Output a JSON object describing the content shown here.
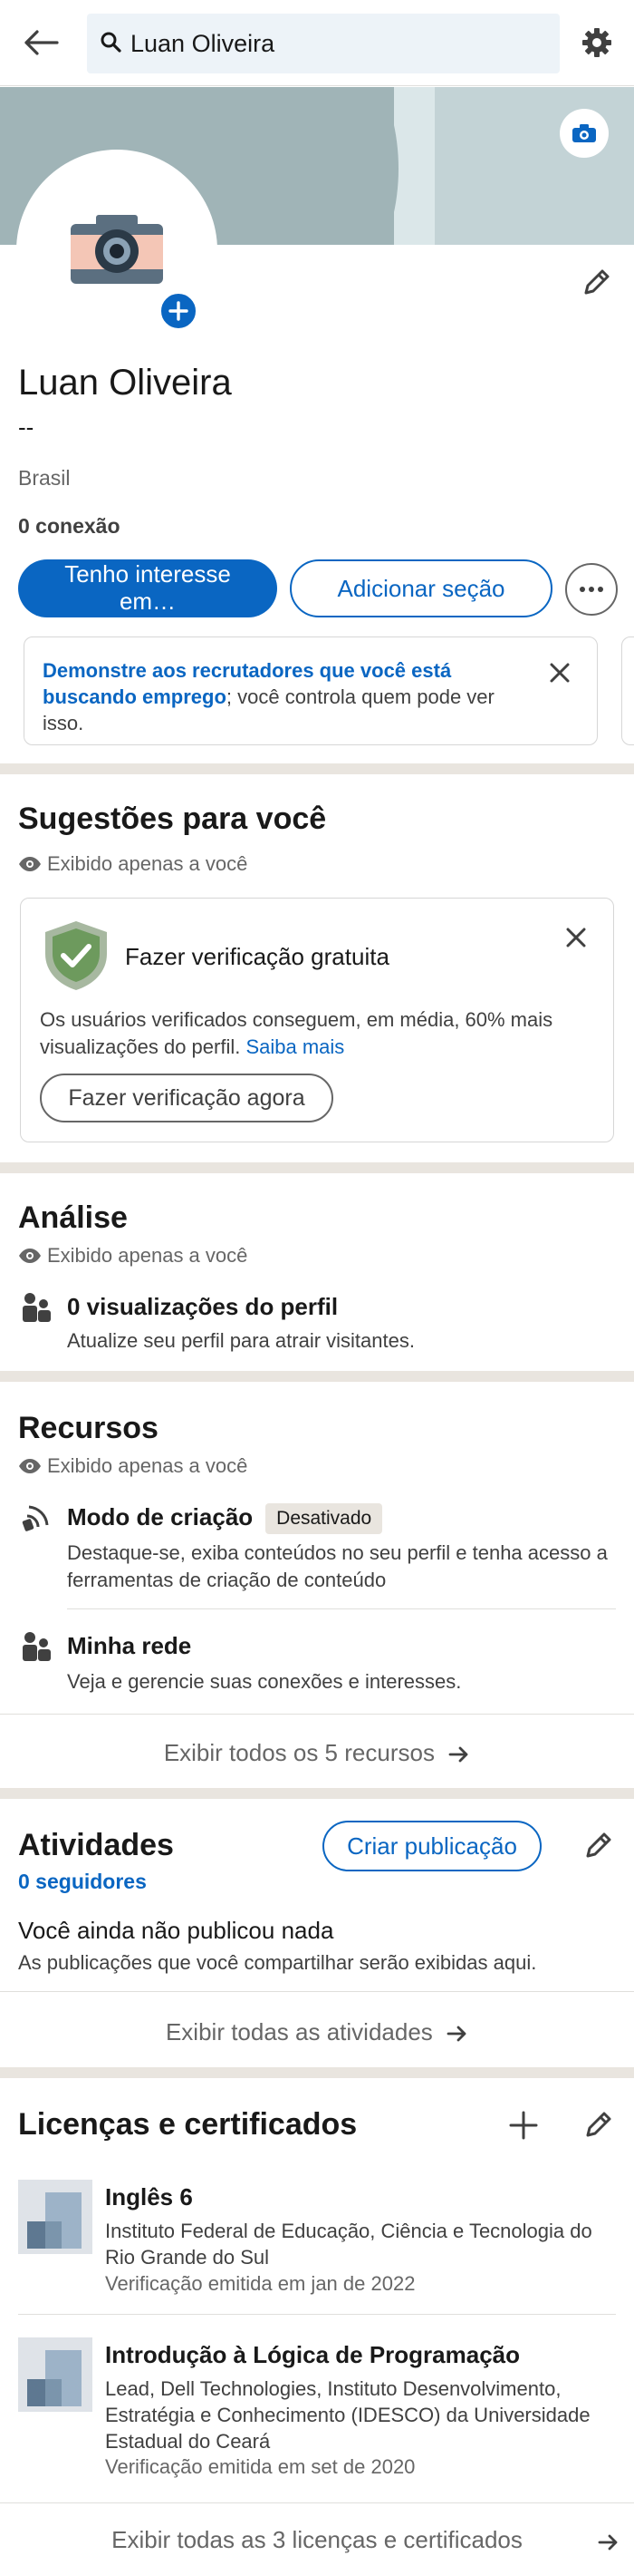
{
  "search": {
    "value": "Luan Oliveira"
  },
  "profile": {
    "name": "Luan Oliveira",
    "headline": "--",
    "location": "Brasil",
    "connections": "0 conexão",
    "primary_button": "Tenho interesse em…",
    "secondary_button": "Adicionar seção"
  },
  "open_to_work": {
    "link_text": "Demonstre aos recrutadores que você está buscando emprego",
    "rest_text": "; você controla quem pode ver isso."
  },
  "suggestions": {
    "title": "Sugestões para você",
    "private_label": "Exibido apenas a você",
    "card_title": "Fazer verificação gratuita",
    "card_text": "Os usuários verificados conseguem, em média, 60% mais visualizações do perfil.",
    "card_link": "Saiba mais",
    "card_button": "Fazer verificação agora"
  },
  "analytics": {
    "title": "Análise",
    "private_label": "Exibido apenas a você",
    "item_title": "0 visualizações do perfil",
    "item_sub": "Atualize seu perfil para atrair visitantes."
  },
  "resources": {
    "title": "Recursos",
    "private_label": "Exibido apenas a você",
    "items": [
      {
        "title": "Modo de criação",
        "badge": "Desativado",
        "sub": "Destaque-se, exiba conteúdos no seu perfil e tenha acesso a ferramentas de criação de conteúdo"
      },
      {
        "title": "Minha rede",
        "sub": "Veja e gerencie suas conexões e interesses."
      }
    ],
    "show_all": "Exibir todos os 5 recursos"
  },
  "activity": {
    "title": "Atividades",
    "create_button": "Criar publicação",
    "followers": "0 seguidores",
    "empty_title": "Você ainda não publicou nada",
    "empty_sub": "As publicações que você compartilhar serão exibidas aqui.",
    "show_all": "Exibir todas as atividades"
  },
  "licenses": {
    "title": "Licenças e certificados",
    "items": [
      {
        "title": "Inglês 6",
        "issuer": "Instituto Federal de Educação, Ciência e Tecnologia do Rio Grande do Sul",
        "date": "Verificação emitida em jan de 2022"
      },
      {
        "title": "Introdução à Lógica de Programação",
        "issuer": "Lead, Dell Technologies, Instituto Desenvolvimento, Estratégia e Conhecimento (IDESCO) da Universidade Estadual do Ceará",
        "date": "Verificação emitida em set de 2020"
      }
    ],
    "show_all": "Exibir todas as 3 licenças e certificados"
  },
  "colors": {
    "accent": "#0a66c2",
    "divider": "#e9e5df",
    "cover": "#a0b4b7",
    "verified_shield": "#6d9a5d"
  },
  "icons": [
    "back-arrow-icon",
    "search-icon",
    "gear-icon",
    "camera-icon",
    "plus-icon",
    "pencil-icon",
    "more-icon",
    "close-icon",
    "eye-icon",
    "shield-check-icon",
    "people-icon",
    "broadcast-icon",
    "arrow-right-icon",
    "certificate-logo-icon"
  ]
}
